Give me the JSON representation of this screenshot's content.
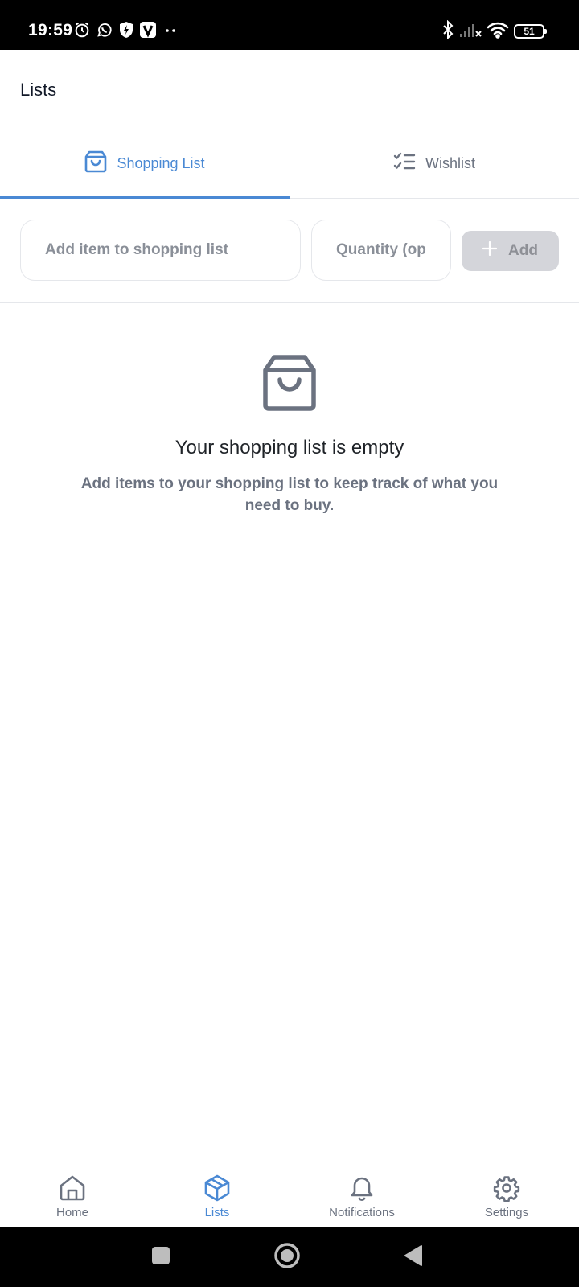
{
  "status_bar": {
    "time": "19:59",
    "battery": "51"
  },
  "header": {
    "title": "Lists"
  },
  "tabs": [
    {
      "label": "Shopping List",
      "icon": "shopping-bag-icon",
      "active": true
    },
    {
      "label": "Wishlist",
      "icon": "checklist-icon",
      "active": false
    }
  ],
  "add_form": {
    "item_placeholder": "Add item to shopping list",
    "quantity_placeholder": "Quantity (optional)",
    "add_label": "Add"
  },
  "empty_state": {
    "icon": "shopping-bag-icon",
    "title": "Your shopping list is empty",
    "description": "Add items to your shopping list to keep track of what you need to buy."
  },
  "bottom_nav": [
    {
      "label": "Home",
      "icon": "home-icon",
      "active": false
    },
    {
      "label": "Lists",
      "icon": "box-icon",
      "active": true
    },
    {
      "label": "Notifications",
      "icon": "bell-icon",
      "active": false
    },
    {
      "label": "Settings",
      "icon": "gear-icon",
      "active": false
    }
  ],
  "colors": {
    "accent": "#4a89d4",
    "muted": "#6b7280",
    "text": "#111827",
    "disabled_button_bg": "#d4d5da"
  }
}
